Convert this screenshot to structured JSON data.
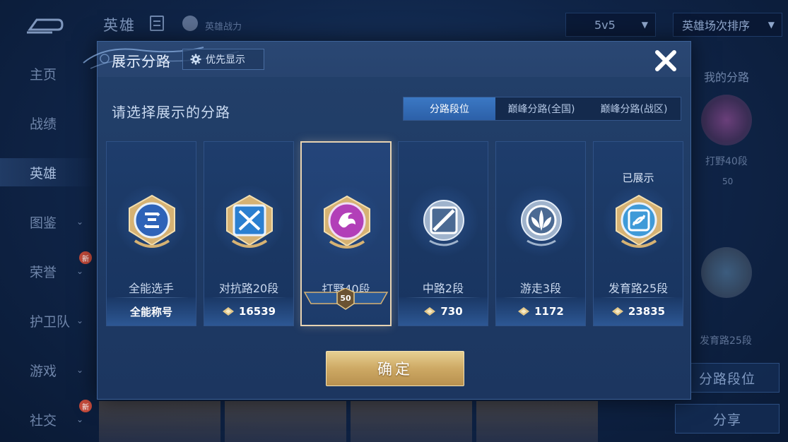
{
  "background": {
    "title": "英雄",
    "hero_power": "英雄战力",
    "mode_select": "5v5",
    "sort_select": "英雄场次排序",
    "nav": [
      {
        "label": "主页",
        "chevron": false,
        "new": false
      },
      {
        "label": "战绩",
        "chevron": false,
        "new": false
      },
      {
        "label": "英雄",
        "chevron": false,
        "new": false,
        "active": true
      },
      {
        "label": "图鉴",
        "chevron": true,
        "new": false
      },
      {
        "label": "荣誉",
        "chevron": true,
        "new": true
      },
      {
        "label": "护卫队",
        "chevron": true,
        "new": false
      },
      {
        "label": "游戏",
        "chevron": true,
        "new": false
      },
      {
        "label": "社交",
        "chevron": true,
        "new": true
      }
    ],
    "new_tag": "新",
    "right_panel": {
      "title": "我的分路",
      "badge1_label": "打野40段",
      "badge1_level": "50",
      "badge2_label": "发育路25段",
      "route_button": "分路段位",
      "share_button": "分享"
    }
  },
  "modal": {
    "title": "展示分路",
    "priority_button": "优先显示",
    "prompt": "请选择展示的分路",
    "tabs": [
      {
        "label": "分路段位",
        "active": true
      },
      {
        "label": "巅峰分路(全国)",
        "active": false
      },
      {
        "label": "巅峰分路(战区)",
        "active": false
      }
    ],
    "cards": [
      {
        "name": "全能选手",
        "footer": "全能称号",
        "score": null,
        "shown": null,
        "selected": false,
        "badge": "allround",
        "color": "#4a7fd0"
      },
      {
        "name": "对抗路20段",
        "footer": null,
        "score": "16539",
        "shown": null,
        "selected": false,
        "badge": "clash",
        "color": "#3c8ad8"
      },
      {
        "name": "打野40段",
        "footer": null,
        "score": null,
        "level": "50",
        "shown": null,
        "selected": true,
        "badge": "jungle",
        "color": "#b23fb8"
      },
      {
        "name": "中路2段",
        "footer": null,
        "score": "730",
        "shown": null,
        "selected": false,
        "badge": "mid",
        "color": "#6f8cb4"
      },
      {
        "name": "游走3段",
        "footer": null,
        "score": "1172",
        "shown": null,
        "selected": false,
        "badge": "roam",
        "color": "#7a93b8"
      },
      {
        "name": "发育路25段",
        "footer": null,
        "score": "23835",
        "shown": "已展示",
        "selected": false,
        "badge": "farm",
        "color": "#3f9ad8"
      }
    ],
    "confirm_button": "确定"
  },
  "colors": {
    "gold": "#d6b273",
    "panel": "#223f69",
    "accent_blue": "#2f6db8"
  }
}
